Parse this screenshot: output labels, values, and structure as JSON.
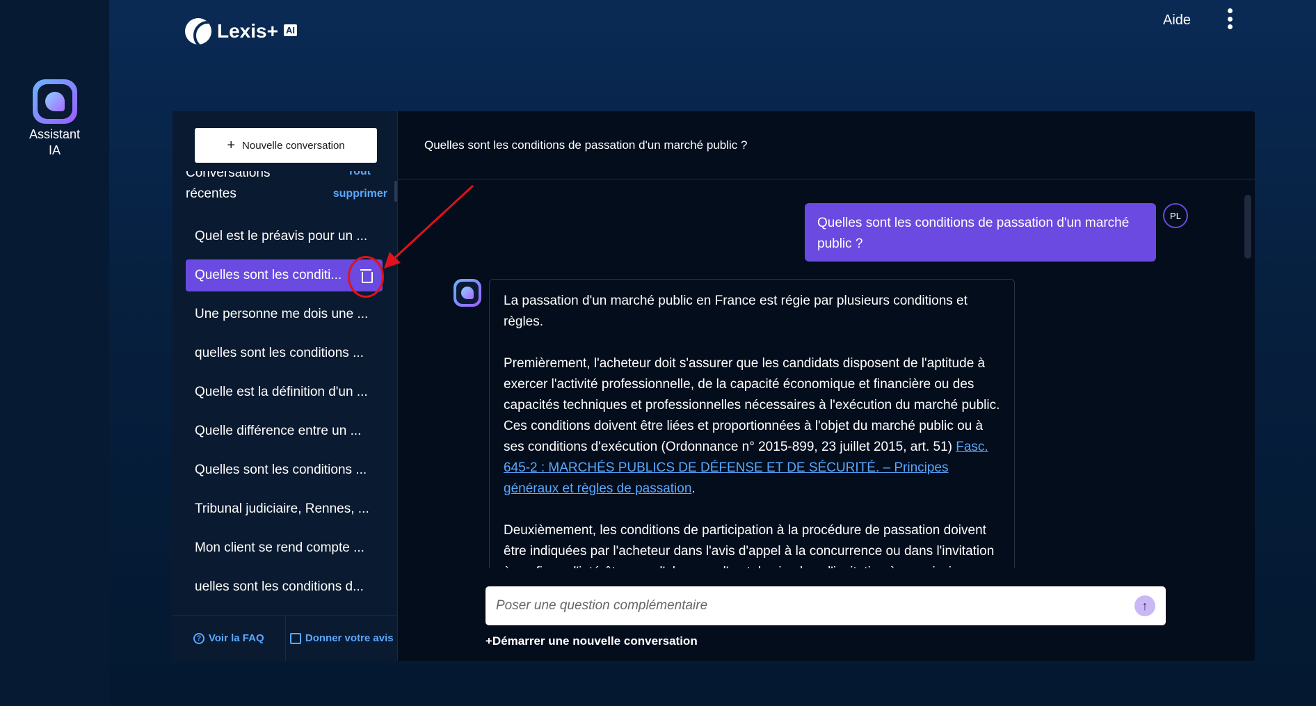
{
  "rail": {
    "label_line1": "Assistant",
    "label_line2": "IA"
  },
  "header": {
    "brand": "Lexis+",
    "brand_badge": "AI",
    "help": "Aide"
  },
  "sidebar": {
    "new_conversation": "Nouvelle conversation",
    "recent_line1": "Conversations",
    "recent_line2": "récentes",
    "delete_all_line1": "Tout",
    "delete_all_line2": "supprimer",
    "conversations": [
      "Quel est le préavis pour un ...",
      "Quelles sont les conditi...",
      "Une personne me dois une ...",
      "quelles sont les conditions ...",
      "Quelle est la définition d'un ...",
      "Quelle différence entre un ...",
      "Quelles sont les conditions ...",
      "Tribunal judiciaire, Rennes, ...",
      "Mon client se rend compte ...",
      "uelles sont les conditions d..."
    ],
    "active_index": 1,
    "faq": "Voir la FAQ",
    "feedback": "Donner votre avis"
  },
  "chat": {
    "title": "Quelles sont les conditions de passation d'un marché public ?",
    "user_question": "Quelles sont les conditions de passation d'un marché public ?",
    "user_initials": "PL",
    "answer_p1": "La passation d'un marché public en France est régie par plusieurs conditions et règles.",
    "answer_p2_text": "Premièrement, l'acheteur doit s'assurer que les candidats disposent de l'aptitude à exercer l'activité professionnelle, de la capacité économique et financière ou des capacités techniques et professionnelles nécessaires à l'exécution du marché public. Ces conditions doivent être liées et proportionnées à l'objet du marché public ou à ses conditions d'exécution (Ordonnance n° 2015-899, 23 juillet 2015, art. 51) ",
    "answer_p2_link": "Fasc. 645-2 : MARCHÉS PUBLICS DE DÉFENSE ET DE SÉCURITÉ. – Principes généraux et règles de passation",
    "answer_p2_end": ".",
    "answer_p3": "Deuxièmement, les conditions de participation à la procédure de passation doivent être indiquées par l'acheteur dans l'avis d'appel à la concurrence ou dans l'invitation à confirmer l'intérêt ou, en l'absence d'un tel avis, dans l'invitation à soumissionner.",
    "input_placeholder": "Poser une question complémentaire",
    "send_symbol": "↑",
    "new_conversation_link": "+Démarrer une nouvelle conversation"
  },
  "colors": {
    "accent": "#6a4ae0",
    "link": "#5aa8ff",
    "annotation": "#e0121b"
  },
  "icons": [
    "assistant-logo-icon",
    "lexis-logo-icon",
    "kebab-menu-icon",
    "plus-icon",
    "trash-icon",
    "help-circle-icon",
    "feedback-icon",
    "send-arrow-icon"
  ]
}
